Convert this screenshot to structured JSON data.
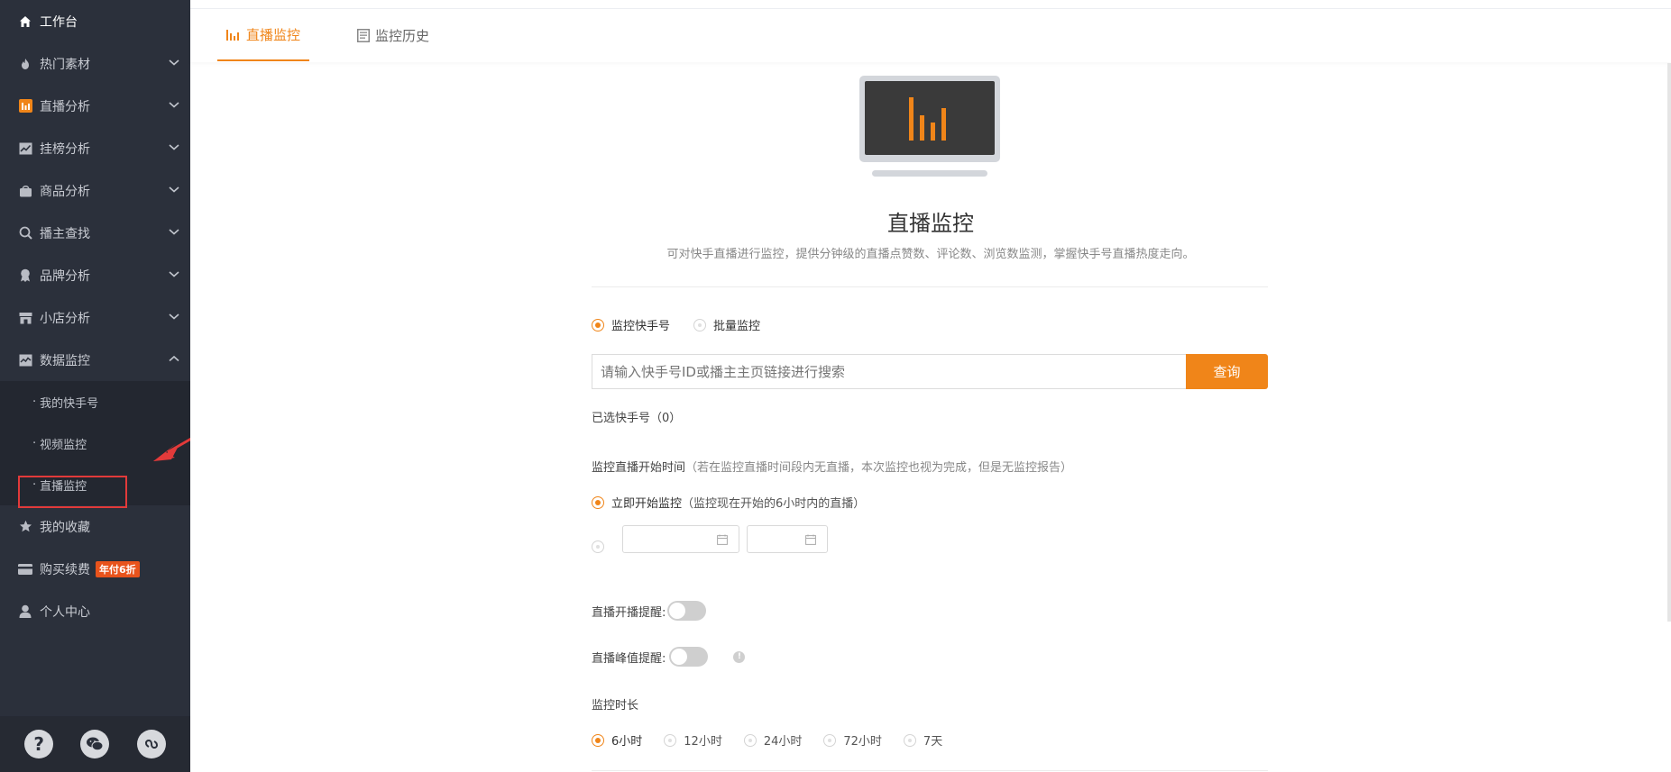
{
  "sidebar": {
    "items": [
      {
        "label": "工作台",
        "icon": "home-icon"
      },
      {
        "label": "热门素材",
        "icon": "fire-icon"
      },
      {
        "label": "直播分析",
        "icon": "bar-chart-icon"
      },
      {
        "label": "挂榜分析",
        "icon": "trend-chart-icon"
      },
      {
        "label": "商品分析",
        "icon": "bag-icon"
      },
      {
        "label": "播主查找",
        "icon": "search-icon"
      },
      {
        "label": "品牌分析",
        "icon": "award-icon"
      },
      {
        "label": "小店分析",
        "icon": "store-icon"
      },
      {
        "label": "数据监控",
        "icon": "monitor-chart-icon"
      }
    ],
    "sub_items": [
      {
        "label": "我的快手号"
      },
      {
        "label": "视频监控"
      },
      {
        "label": "直播监控"
      }
    ],
    "bottom_items": [
      {
        "label": "我的收藏",
        "icon": "star-icon"
      },
      {
        "label": "购买续费",
        "icon": "card-icon",
        "badge": "年付6折"
      },
      {
        "label": "个人中心",
        "icon": "user-icon"
      }
    ],
    "footer_icons": [
      "help-icon",
      "wechat-icon",
      "link-icon"
    ],
    "footer_help_glyph": "?"
  },
  "tabs": [
    {
      "label": "直播监控",
      "active": true
    },
    {
      "label": "监控历史",
      "active": false
    }
  ],
  "content": {
    "title": "直播监控",
    "description": "可对快手直播进行监控，提供分钟级的直播点赞数、评论数、浏览数监测，掌握快手号直播热度走向。",
    "mode_options": [
      {
        "label": "监控快手号",
        "selected": true
      },
      {
        "label": "批量监控",
        "selected": false
      }
    ],
    "search_placeholder": "请输入快手号ID或播主主页链接进行搜索",
    "search_button": "查询",
    "selected_label": "已选快手号（0）",
    "start_time_label": "监控直播开始时间",
    "start_time_hint": "（若在监控直播时间段内无直播，本次监控也视为完成，但是无监控报告）",
    "start_now_label": "立即开始监控",
    "start_now_hint": "（监控现在开始的6小时内的直播）",
    "live_start_reminder": "直播开播提醒:",
    "live_peak_reminder": "直播峰值提醒:",
    "info_glyph": "!",
    "duration_label": "监控时长",
    "duration_options": [
      {
        "label": "6小时",
        "selected": true
      },
      {
        "label": "12小时",
        "selected": false
      },
      {
        "label": "24小时",
        "selected": false
      },
      {
        "label": "72小时",
        "selected": false
      },
      {
        "label": "7天",
        "selected": false
      }
    ]
  },
  "colors": {
    "accent": "#f08519",
    "sidebar_bg": "#2b303b",
    "annotation_red": "#e23a3a"
  }
}
